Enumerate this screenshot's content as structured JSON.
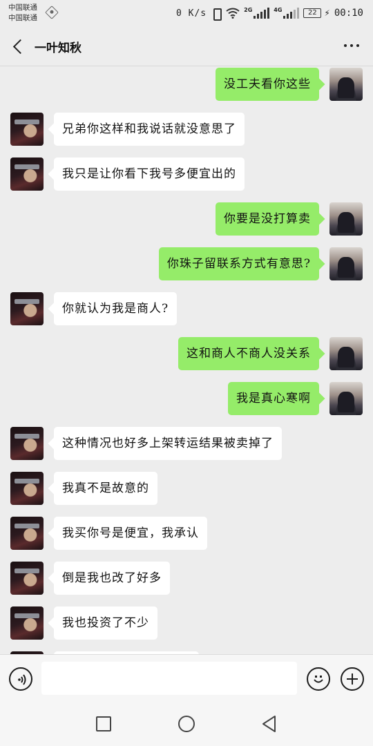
{
  "status_bar": {
    "carrier_1": "中国联通",
    "carrier_2": "中国联通",
    "net_speed": "0 K/s",
    "net_type_1": "2G",
    "net_type_2": "4G",
    "battery": "22",
    "time": "00:10"
  },
  "header": {
    "title": "一叶知秋"
  },
  "messages": [
    {
      "side": "right",
      "text": "没工夫看你这些"
    },
    {
      "side": "left",
      "text": "兄弟你这样和我说话就没意思了"
    },
    {
      "side": "left",
      "text": "我只是让你看下我号多便宜出的"
    },
    {
      "side": "right",
      "text": "你要是没打算卖"
    },
    {
      "side": "right",
      "text": "你珠子留联系方式有意思?"
    },
    {
      "side": "left",
      "text": "你就认为我是商人?"
    },
    {
      "side": "right",
      "text": "这和商人不商人没关系"
    },
    {
      "side": "right",
      "text": "我是真心寒啊"
    },
    {
      "side": "left",
      "text": "这种情况也好多上架转运结果被卖掉了"
    },
    {
      "side": "left",
      "text": "我真不是故意的"
    },
    {
      "side": "left",
      "text": "我买你号是便宜，我承认"
    },
    {
      "side": "left",
      "text": "倒是我也改了好多"
    },
    {
      "side": "left",
      "text": "我也投资了不少"
    }
  ],
  "input_bar": {
    "value": "",
    "placeholder": ""
  },
  "colors": {
    "background": "#ededed",
    "sent_bubble": "#95ec69",
    "received_bubble": "#ffffff"
  }
}
